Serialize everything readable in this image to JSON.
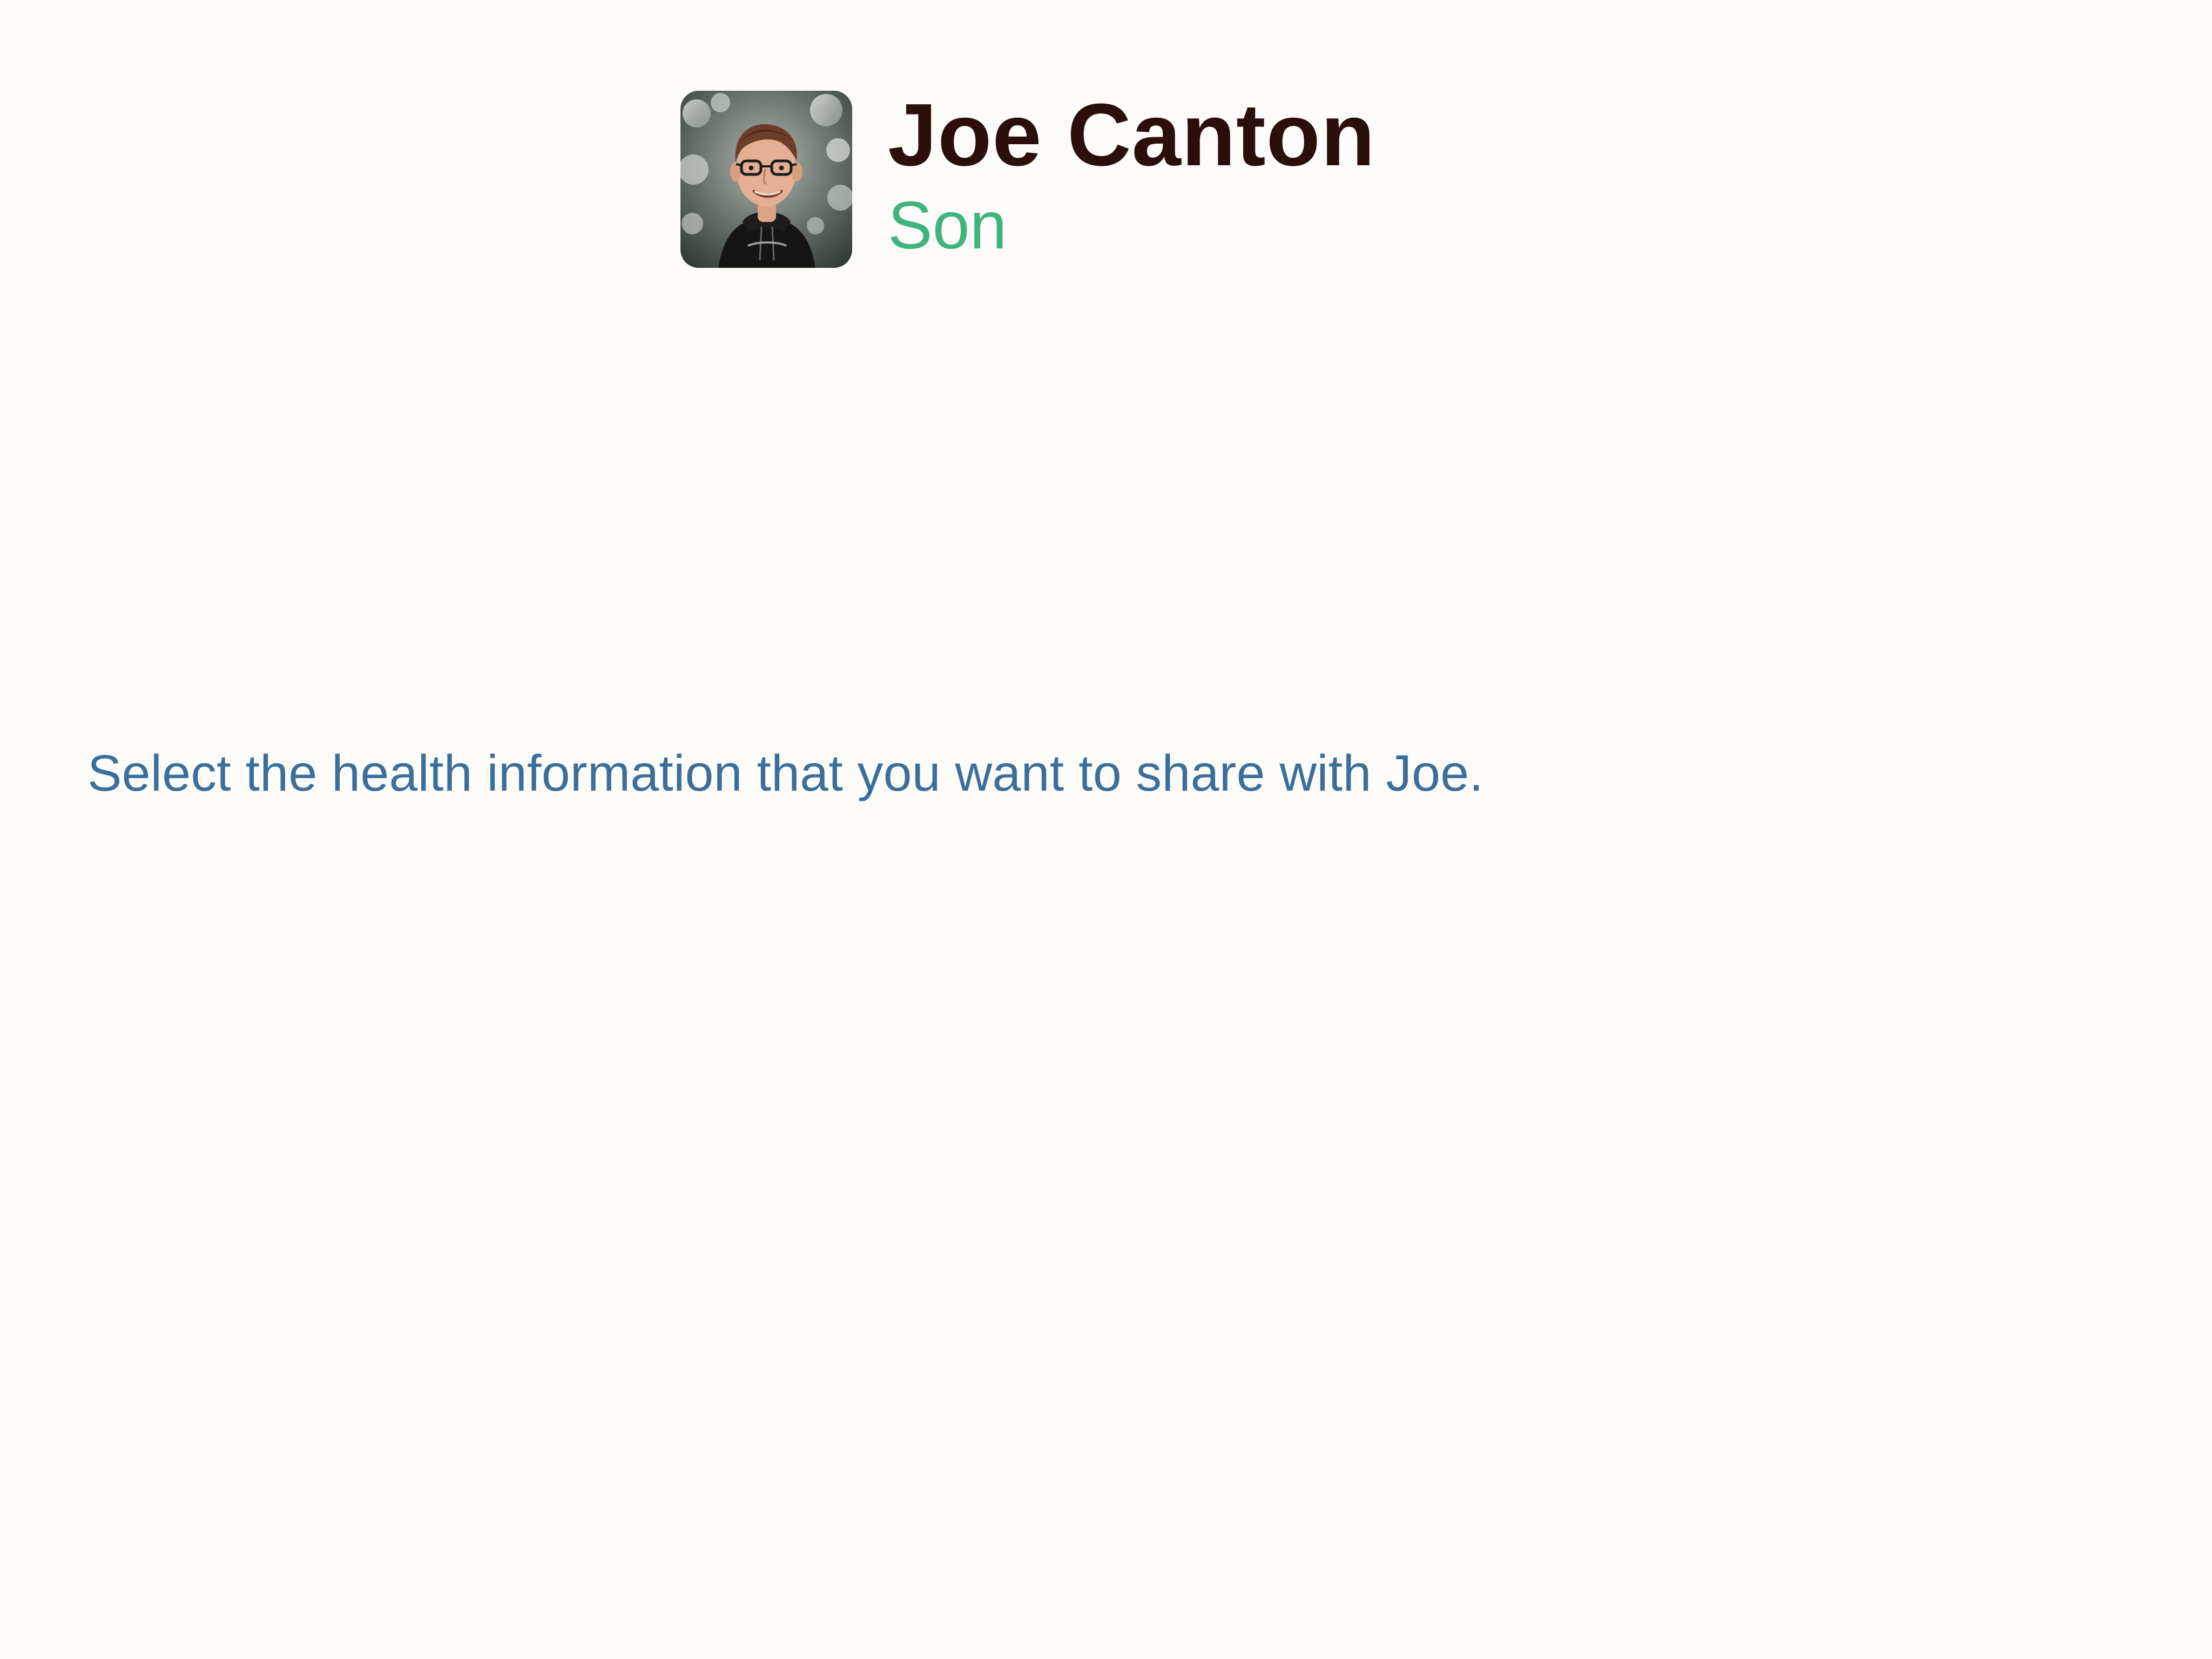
{
  "profile": {
    "name": "Joe Canton",
    "relation": "Son",
    "avatar_icon": "avatar-photo"
  },
  "instruction": {
    "text": "Select the health information that you want to share with Joe."
  },
  "colors": {
    "background": "#fefcf8",
    "name": "#2a0f0b",
    "relation": "#3fb57d",
    "instruction": "#3b6f9b"
  }
}
